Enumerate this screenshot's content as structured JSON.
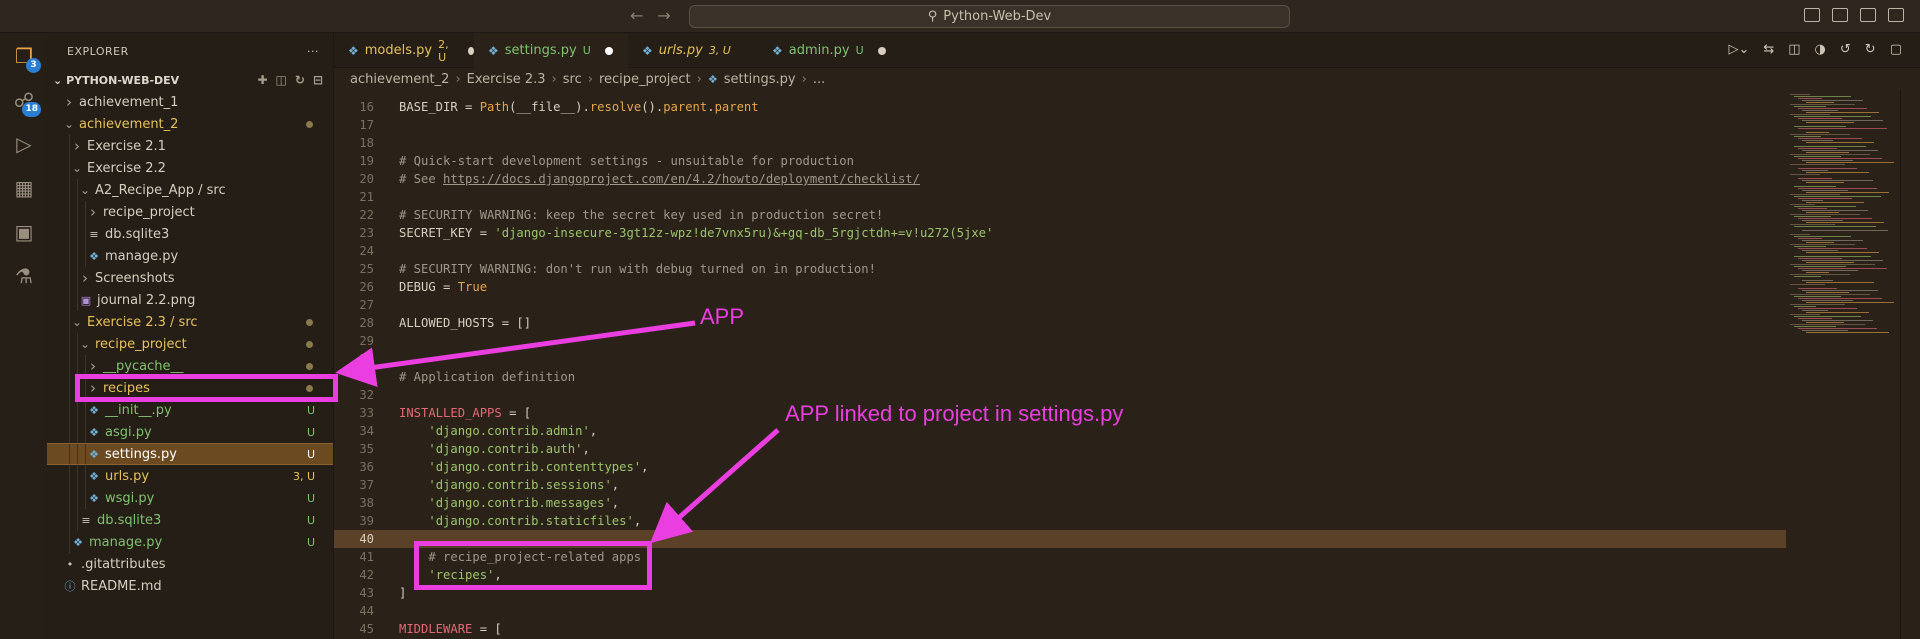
{
  "window": {
    "title": "Python-Web-Dev",
    "search_icon": "search-icon"
  },
  "activity_badges": {
    "explorer": "3",
    "source_control": "18"
  },
  "sidebar": {
    "header": "EXPLORER",
    "more": "···",
    "root": "PYTHON-WEB-DEV",
    "items": [
      {
        "label": "achievement_1",
        "depth": 0,
        "kind": "folder",
        "open": false,
        "color": "plain",
        "status": ""
      },
      {
        "label": "achievement_2",
        "depth": 0,
        "kind": "folder",
        "open": true,
        "color": "mod",
        "status": "dot"
      },
      {
        "label": "Exercise 2.1",
        "depth": 1,
        "kind": "folder",
        "open": false,
        "color": "plain",
        "status": ""
      },
      {
        "label": "Exercise 2.2",
        "depth": 1,
        "kind": "folder",
        "open": true,
        "color": "plain",
        "status": ""
      },
      {
        "label": "A2_Recipe_App / src",
        "depth": 2,
        "kind": "folder",
        "open": true,
        "color": "plain",
        "status": ""
      },
      {
        "label": "recipe_project",
        "depth": 3,
        "kind": "folder",
        "open": false,
        "color": "plain",
        "status": ""
      },
      {
        "label": "db.sqlite3",
        "depth": 3,
        "kind": "file-db",
        "open": false,
        "color": "plain",
        "status": ""
      },
      {
        "label": "manage.py",
        "depth": 3,
        "kind": "file-py",
        "open": false,
        "color": "plain",
        "status": ""
      },
      {
        "label": "Screenshots",
        "depth": 2,
        "kind": "folder",
        "open": false,
        "color": "plain",
        "status": ""
      },
      {
        "label": "journal 2.2.png",
        "depth": 2,
        "kind": "file-img",
        "open": false,
        "color": "plain",
        "status": ""
      },
      {
        "label": "Exercise 2.3 / src",
        "depth": 1,
        "kind": "folder",
        "open": true,
        "color": "mod",
        "status": "dot"
      },
      {
        "label": "recipe_project",
        "depth": 2,
        "kind": "folder",
        "open": true,
        "color": "mod",
        "status": "dot"
      },
      {
        "label": "__pycache__",
        "depth": 3,
        "kind": "folder",
        "open": false,
        "color": "new",
        "status": "dot"
      },
      {
        "label": "recipes",
        "depth": 3,
        "kind": "folder",
        "open": false,
        "color": "mod",
        "status": "dot"
      },
      {
        "label": "__init__.py",
        "depth": 3,
        "kind": "file-py",
        "open": false,
        "color": "new",
        "status": "U"
      },
      {
        "label": "asgi.py",
        "depth": 3,
        "kind": "file-py",
        "open": false,
        "color": "new",
        "status": "U"
      },
      {
        "label": "settings.py",
        "depth": 3,
        "kind": "file-py",
        "open": false,
        "color": "selected",
        "status": "U"
      },
      {
        "label": "urls.py",
        "depth": 3,
        "kind": "file-py",
        "open": false,
        "color": "mod",
        "status": "3, U"
      },
      {
        "label": "wsgi.py",
        "depth": 3,
        "kind": "file-py",
        "open": false,
        "color": "new",
        "status": "U"
      },
      {
        "label": "db.sqlite3",
        "depth": 2,
        "kind": "file-db",
        "open": false,
        "color": "new",
        "status": "U"
      },
      {
        "label": "manage.py",
        "depth": 1,
        "kind": "file-py",
        "open": false,
        "color": "new",
        "status": "U"
      },
      {
        "label": ".gitattributes",
        "depth": 0,
        "kind": "file-git",
        "open": false,
        "color": "plain",
        "status": ""
      },
      {
        "label": "README.md",
        "depth": 0,
        "kind": "file-info",
        "open": false,
        "color": "plain",
        "status": ""
      }
    ]
  },
  "tabs": [
    {
      "label": "models.py",
      "meta": "2, U",
      "active": false,
      "italic": false,
      "color": "mod",
      "dirty": true
    },
    {
      "label": "settings.py",
      "meta": "U",
      "active": true,
      "italic": false,
      "color": "new",
      "dirty": true
    },
    {
      "label": "urls.py",
      "meta": "3, U",
      "active": false,
      "italic": true,
      "color": "mod",
      "dirty": false
    },
    {
      "label": "admin.py",
      "meta": "U",
      "active": false,
      "italic": false,
      "color": "new",
      "dirty": true
    }
  ],
  "breadcrumbs": [
    "achievement_2",
    "Exercise 2.3",
    "src",
    "recipe_project",
    "settings.py",
    "..."
  ],
  "code": {
    "current_line": 40,
    "lines": [
      {
        "n": "16",
        "tokens": [
          [
            "p",
            "BASE_DIR = "
          ],
          [
            "fn",
            "Path"
          ],
          [
            "p",
            "("
          ],
          [
            "p",
            "__file__"
          ],
          [
            "p",
            ")."
          ],
          [
            "fn",
            "resolve"
          ],
          [
            "p",
            "()."
          ],
          [
            "fn",
            "parent"
          ],
          [
            "p",
            "."
          ],
          [
            "fn",
            "parent"
          ]
        ]
      },
      {
        "n": "17",
        "tokens": []
      },
      {
        "n": "18",
        "tokens": []
      },
      {
        "n": "19",
        "tokens": [
          [
            "cm",
            "# Quick-start development settings - unsuitable for production"
          ]
        ]
      },
      {
        "n": "20",
        "tokens": [
          [
            "cm",
            "# See "
          ],
          [
            "link",
            "https://docs.djangoproject.com/en/4.2/howto/deployment/checklist/"
          ]
        ]
      },
      {
        "n": "21",
        "tokens": []
      },
      {
        "n": "22",
        "tokens": [
          [
            "cm",
            "# SECURITY WARNING: keep the secret key used in production secret!"
          ]
        ]
      },
      {
        "n": "23",
        "tokens": [
          [
            "p",
            "SECRET_KEY = "
          ],
          [
            "str",
            "'django-insecure-3gt12z-wpz!de7vnx5ru)&+gq-db_5rgjctdn+=v!u272(5jxe'"
          ]
        ]
      },
      {
        "n": "24",
        "tokens": []
      },
      {
        "n": "25",
        "tokens": [
          [
            "cm",
            "# SECURITY WARNING: don't run with debug turned on in production!"
          ]
        ]
      },
      {
        "n": "26",
        "tokens": [
          [
            "p",
            "DEBUG = "
          ],
          [
            "num",
            "True"
          ]
        ]
      },
      {
        "n": "27",
        "tokens": []
      },
      {
        "n": "28",
        "tokens": [
          [
            "p",
            "ALLOWED_HOSTS = []"
          ]
        ]
      },
      {
        "n": "29",
        "tokens": []
      },
      {
        "n": "30",
        "tokens": []
      },
      {
        "n": "31",
        "tokens": [
          [
            "cm",
            "# Application definition"
          ]
        ]
      },
      {
        "n": "32",
        "tokens": []
      },
      {
        "n": "33",
        "tokens": [
          [
            "kw",
            "INSTALLED_APPS"
          ],
          [
            "p",
            " = ["
          ]
        ]
      },
      {
        "n": "34",
        "tokens": [
          [
            "p",
            "    "
          ],
          [
            "str",
            "'django.contrib.admin'"
          ],
          [
            "p",
            ","
          ]
        ]
      },
      {
        "n": "35",
        "tokens": [
          [
            "p",
            "    "
          ],
          [
            "str",
            "'django.contrib.auth'"
          ],
          [
            "p",
            ","
          ]
        ]
      },
      {
        "n": "36",
        "tokens": [
          [
            "p",
            "    "
          ],
          [
            "str",
            "'django.contrib.contenttypes'"
          ],
          [
            "p",
            ","
          ]
        ]
      },
      {
        "n": "37",
        "tokens": [
          [
            "p",
            "    "
          ],
          [
            "str",
            "'django.contrib.sessions'"
          ],
          [
            "p",
            ","
          ]
        ]
      },
      {
        "n": "38",
        "tokens": [
          [
            "p",
            "    "
          ],
          [
            "str",
            "'django.contrib.messages'"
          ],
          [
            "p",
            ","
          ]
        ]
      },
      {
        "n": "39",
        "tokens": [
          [
            "p",
            "    "
          ],
          [
            "str",
            "'django.contrib.staticfiles'"
          ],
          [
            "p",
            ","
          ]
        ]
      },
      {
        "n": "40",
        "tokens": []
      },
      {
        "n": "41",
        "tokens": [
          [
            "p",
            "    "
          ],
          [
            "cm",
            "# recipe_project-related apps"
          ]
        ]
      },
      {
        "n": "42",
        "tokens": [
          [
            "p",
            "    "
          ],
          [
            "str",
            "'recipes'"
          ],
          [
            "p",
            ","
          ]
        ]
      },
      {
        "n": "43",
        "tokens": [
          [
            "p",
            "]"
          ]
        ]
      },
      {
        "n": "44",
        "tokens": []
      },
      {
        "n": "45",
        "tokens": [
          [
            "kw",
            "MIDDLEWARE"
          ],
          [
            "p",
            " = ["
          ]
        ]
      }
    ]
  },
  "annotations": {
    "app_label": "APP",
    "linked_label": "APP linked to project in settings.py"
  },
  "colors": {
    "accent": "#ea3ee0",
    "modified": "#e6c15a",
    "untracked": "#7fc26e",
    "selection": "#6b4a22"
  }
}
